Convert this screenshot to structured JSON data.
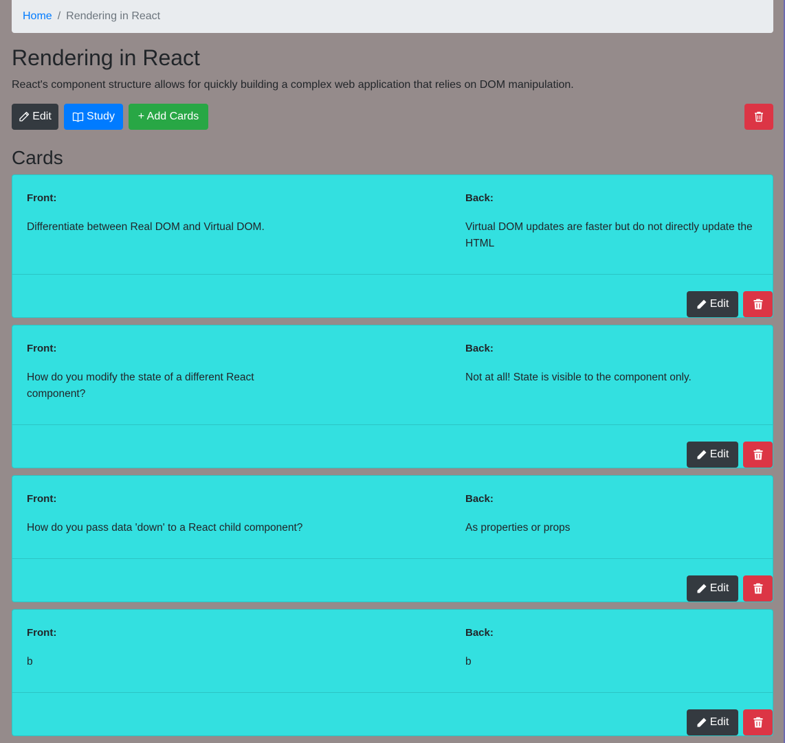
{
  "breadcrumb": {
    "home": "Home",
    "separator": "/",
    "current": "Rendering in React"
  },
  "deck": {
    "title": "Rendering in React",
    "description": "React's component structure allows for quickly building a complex web application that relies on DOM manipulation."
  },
  "toolbar": {
    "edit_label": "Edit",
    "study_label": "Study",
    "add_cards_label": "+ Add Cards",
    "delete_icon": "trash-icon"
  },
  "cards_heading": "Cards",
  "cards": [
    {
      "front_label": "Front:",
      "front": "Differentiate between Real DOM and Virtual DOM.",
      "back_label": "Back:",
      "back": "Virtual DOM updates are faster but do not directly update the HTML",
      "edit_label": "Edit"
    },
    {
      "front_label": "Front:",
      "front": "How do you modify the state of a different React component?",
      "back_label": "Back:",
      "back": "Not at all! State is visible to the component only.",
      "edit_label": "Edit"
    },
    {
      "front_label": "Front:",
      "front": "How do you pass data 'down' to a React child component?",
      "back_label": "Back:",
      "back": "As properties or props",
      "edit_label": "Edit"
    },
    {
      "front_label": "Front:",
      "front": "b",
      "back_label": "Back:",
      "back": "b",
      "edit_label": "Edit"
    }
  ],
  "colors": {
    "page_bg": "#958b8b",
    "card_bg": "#33e0e0",
    "dark": "#343a40",
    "primary": "#007bff",
    "success": "#28a745",
    "danger": "#dc3545"
  }
}
